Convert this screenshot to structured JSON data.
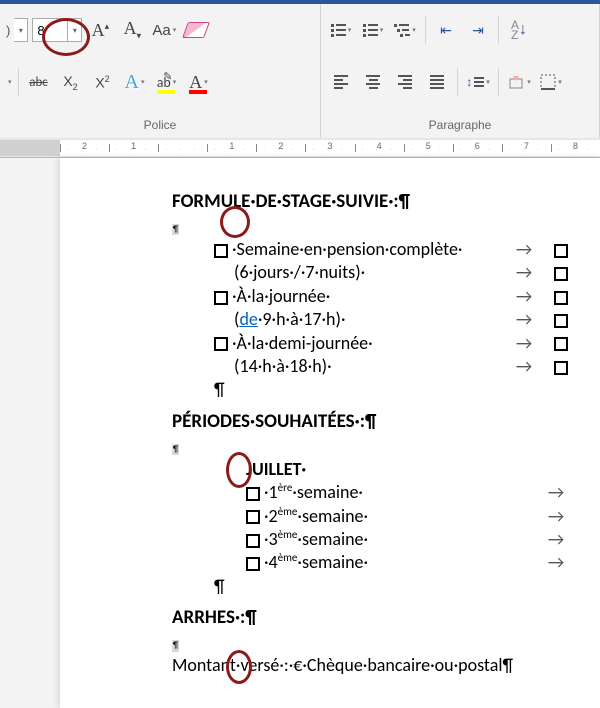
{
  "ribbon": {
    "font_size": "8",
    "police_label": "Police",
    "paragraphe_label": "Paragraphe"
  },
  "ruler": {
    "labels": [
      "2",
      "1",
      "",
      "1",
      "2",
      "3",
      "4",
      "5",
      "6",
      "7",
      "8"
    ]
  },
  "doc": {
    "heading1": "FORMULE·DE·STAGE·SUIVIE·:¶",
    "smallp": "¶",
    "item1a": "·Semaine·en·pension·complète·",
    "item1b": "(6·jours·/·7·nuits)·",
    "item2a": "·À·la·journée·",
    "item2b": "(de·9·h·à·17·h)·",
    "item3a": "·À·la·demi-journée·",
    "item3b": "(14·h·à·18·h)·",
    "pil": "¶",
    "heading2": "PÉRIODES·SOUHAITÉES·:¶",
    "juillet": "JUILLET·",
    "w1a": "·1",
    "w1s": "ère",
    "w1b": "·semaine·",
    "w2a": "·2",
    "w2s": "ème",
    "w2b": "·semaine·",
    "w3a": "·3",
    "w3s": "ème",
    "w3b": "·semaine·",
    "w4a": "·4",
    "w4s": "ème",
    "w4b": "·semaine·",
    "heading3": "ARRHES·:¶",
    "montant": "Montant·versé·:·€·Chèque·bancaire·ou·postal¶",
    "arrow": "→",
    "de_link": "de"
  }
}
